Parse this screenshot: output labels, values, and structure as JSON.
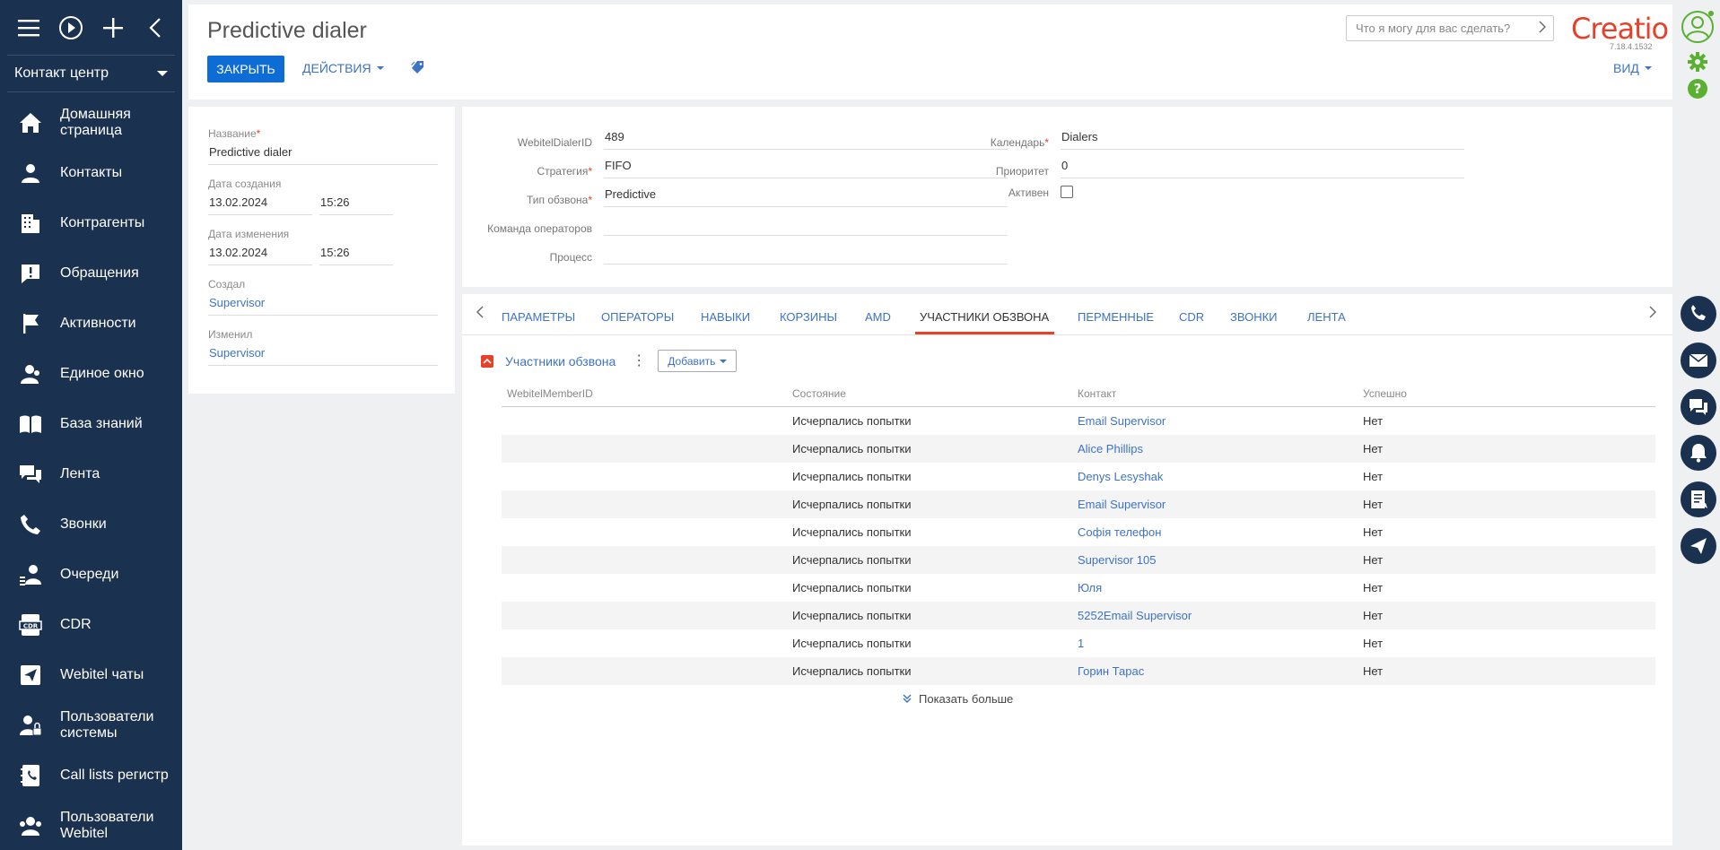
{
  "sidebar": {
    "workspace": "Контакт центр",
    "items": [
      {
        "label": "Домашняя страница",
        "icon": "home-icon"
      },
      {
        "label": "Контакты",
        "icon": "contact-icon"
      },
      {
        "label": "Контрагенты",
        "icon": "building-icon"
      },
      {
        "label": "Обращения",
        "icon": "case-icon"
      },
      {
        "label": "Активности",
        "icon": "flag-icon"
      },
      {
        "label": "Единое окно",
        "icon": "agent-icon"
      },
      {
        "label": "База знаний",
        "icon": "book-icon"
      },
      {
        "label": "Лента",
        "icon": "feed-icon"
      },
      {
        "label": "Звонки",
        "icon": "phone-icon"
      },
      {
        "label": "Очереди",
        "icon": "queue-icon"
      },
      {
        "label": "CDR",
        "icon": "cdr-icon"
      },
      {
        "label": "Webitel чаты",
        "icon": "send-icon"
      },
      {
        "label": "Пользователи системы",
        "icon": "user-lock-icon"
      },
      {
        "label": "Call lists регистр",
        "icon": "contact-book-icon"
      },
      {
        "label": "Пользователи Webitel",
        "icon": "users-icon"
      }
    ]
  },
  "header": {
    "title": "Predictive dialer",
    "close_label": "ЗАКРЫТЬ",
    "actions_label": "ДЕЙСТВИЯ",
    "view_label": "ВИД",
    "search_placeholder": "Что я могу для вас сделать?",
    "logo_text": "Creatio",
    "version": "7.18.4.1532"
  },
  "info": {
    "name_label": "Название",
    "name_value": "Predictive dialer",
    "created_label": "Дата создания",
    "created_date": "13.02.2024",
    "created_time": "15:26",
    "modified_label": "Дата изменения",
    "modified_date": "13.02.2024",
    "modified_time": "15:26",
    "createdby_label": "Создал",
    "createdby_value": "Supervisor",
    "modifiedby_label": "Изменил",
    "modifiedby_value": "Supervisor"
  },
  "main": {
    "dialer_id_label": "WebitelDialerID",
    "dialer_id_value": "489",
    "strategy_label": "Стратегия",
    "strategy_value": "FIFO",
    "type_label": "Тип обзвона",
    "type_value": "Predictive",
    "team_label": "Команда операторов",
    "team_value": "",
    "process_label": "Процесс",
    "process_value": "",
    "calendar_label": "Календарь",
    "calendar_value": "Dialers",
    "priority_label": "Приоритет",
    "priority_value": "0",
    "active_label": "Активен",
    "active_value": false
  },
  "tabs": [
    "ПАРАМЕТРЫ",
    "ОПЕРАТОРЫ",
    "НАВЫКИ",
    "КОРЗИНЫ",
    "AMD",
    "УЧАСТНИКИ ОБЗВОНА",
    "ПЕРМЕННЫЕ",
    "CDR",
    "ЗВОНКИ",
    "ЛЕНТА"
  ],
  "active_tab": "УЧАСТНИКИ ОБЗВОНА",
  "detail": {
    "title": "Участники обзвона",
    "add_label": "Добавить",
    "columns": [
      "WebitelMemberID",
      "Состояние",
      "Контакт",
      "Успешно"
    ],
    "rows": [
      {
        "id": "",
        "state": "Исчерпались попытки",
        "contact": "Email Supervisor",
        "success": "Нет"
      },
      {
        "id": "",
        "state": "Исчерпались попытки",
        "contact": "Alice Phillips",
        "success": "Нет"
      },
      {
        "id": "",
        "state": "Исчерпались попытки",
        "contact": "Denys Lesyshak",
        "success": "Нет"
      },
      {
        "id": "",
        "state": "Исчерпались попытки",
        "contact": "Email Supervisor",
        "success": "Нет"
      },
      {
        "id": "",
        "state": "Исчерпались попытки",
        "contact": "Софія телефон",
        "success": "Нет"
      },
      {
        "id": "",
        "state": "Исчерпались попытки",
        "contact": "Supervisor 105",
        "success": "Нет"
      },
      {
        "id": "",
        "state": "Исчерпались попытки",
        "contact": "Юля",
        "success": "Нет"
      },
      {
        "id": "",
        "state": "Исчерпались попытки",
        "contact": "5252Email Supervisor",
        "success": "Нет"
      },
      {
        "id": "",
        "state": "Исчерпались попытки",
        "contact": "1",
        "success": "Нет"
      },
      {
        "id": "",
        "state": "Исчерпались попытки",
        "contact": "Горин Тарас",
        "success": "Нет"
      }
    ],
    "show_more_label": "Показать больше"
  },
  "colors": {
    "sidebar_bg": "#1a3150",
    "primary_button": "#0e6dd5",
    "link": "#3d73c4",
    "accent": "#e8412b",
    "right_panel_icon": "#1a3150",
    "right_panel_green": "#5ab031"
  }
}
